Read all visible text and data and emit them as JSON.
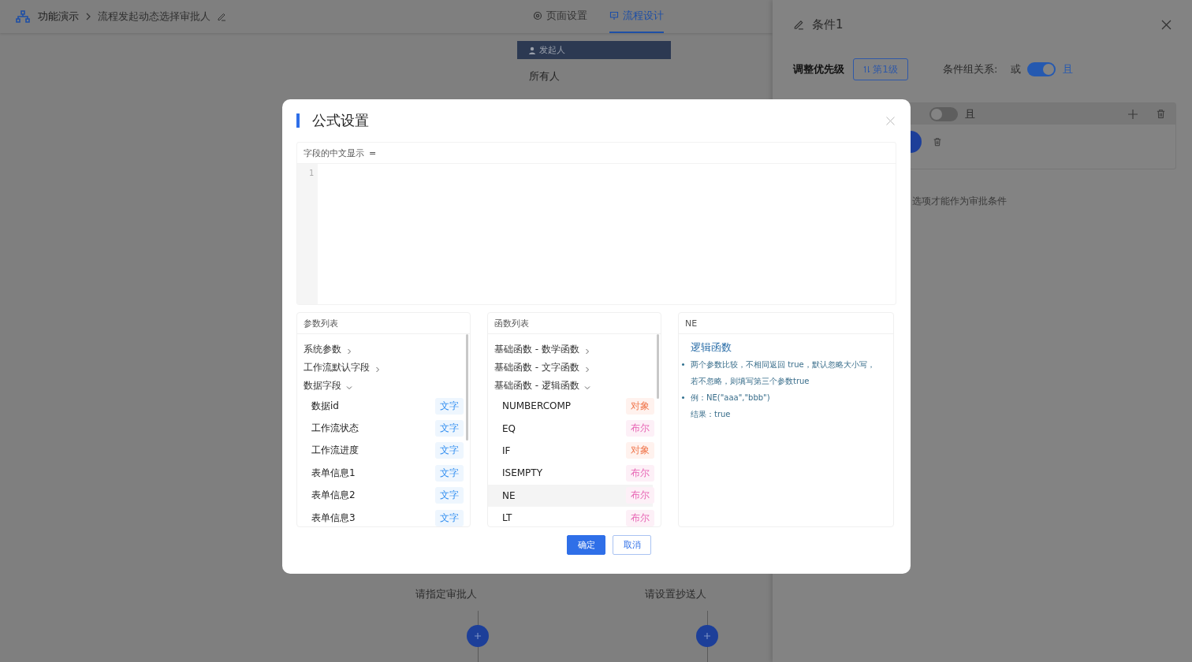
{
  "header": {
    "breadcrumb": [
      {
        "label": "功能演示"
      },
      {
        "label": "流程发起动态选择审批人"
      }
    ],
    "tabs": [
      {
        "label": "页面设置",
        "selected": false
      },
      {
        "label": "流程设计",
        "selected": true
      }
    ]
  },
  "flow": {
    "start_node": {
      "title": "发起人",
      "content": "所有人"
    },
    "branches": [
      {
        "label": "请指定审批人"
      },
      {
        "label": "请设置抄送人"
      }
    ]
  },
  "drawer": {
    "title": "条件1",
    "priority_label": "调整优先级",
    "priority_button": "第1级",
    "relation_label": "条件组关系:",
    "or_label": "或",
    "and_label": "且",
    "relation_on": true,
    "group": {
      "on": false,
      "and_label": "且"
    },
    "hint": "选项才能作为审批条件"
  },
  "modal": {
    "title": "公式设置",
    "editor": {
      "label": "字段的中文显示",
      "operator": "=",
      "line_numbers": [
        "1"
      ]
    },
    "params": {
      "title": "参数列表",
      "groups": [
        {
          "label": "系统参数",
          "expanded": false
        },
        {
          "label": "工作流默认字段",
          "expanded": false
        },
        {
          "label": "数据字段",
          "expanded": true,
          "children": [
            {
              "name": "数据id",
              "tag": "文字",
              "kind": "text",
              "selected": false
            },
            {
              "name": "工作流状态",
              "tag": "文字",
              "kind": "text",
              "selected": false
            },
            {
              "name": "工作流进度",
              "tag": "文字",
              "kind": "text",
              "selected": false
            },
            {
              "name": "表单信息1",
              "tag": "文字",
              "kind": "text",
              "selected": false
            },
            {
              "name": "表单信息2",
              "tag": "文字",
              "kind": "text",
              "selected": false
            },
            {
              "name": "表单信息3",
              "tag": "文字",
              "kind": "text",
              "selected": false
            }
          ]
        }
      ]
    },
    "functions": {
      "title": "函数列表",
      "groups": [
        {
          "label": "基础函数 - 数学函数",
          "expanded": false
        },
        {
          "label": "基础函数 - 文字函数",
          "expanded": false
        },
        {
          "label": "基础函数 - 逻辑函数",
          "expanded": true,
          "children": [
            {
              "name": "NUMBERCOMP",
              "tag": "对象",
              "kind": "object",
              "selected": false
            },
            {
              "name": "EQ",
              "tag": "布尔",
              "kind": "boolean",
              "selected": false
            },
            {
              "name": "IF",
              "tag": "对象",
              "kind": "object",
              "selected": false
            },
            {
              "name": "ISEMPTY",
              "tag": "布尔",
              "kind": "boolean",
              "selected": false
            },
            {
              "name": "NE",
              "tag": "布尔",
              "kind": "boolean",
              "selected": true
            },
            {
              "name": "LT",
              "tag": "布尔",
              "kind": "boolean",
              "selected": false
            }
          ]
        }
      ]
    },
    "detail": {
      "title": "NE",
      "heading": "逻辑函数",
      "bullets": [
        {
          "lines": [
            "两个参数比较，不相同返回 true，默认忽略大小写，",
            "若不忽略，则填写第三个参数true"
          ]
        },
        {
          "lines": [
            "例：NE(\"aaa\",\"bbb\")",
            "结果：true"
          ]
        }
      ]
    },
    "buttons": [
      {
        "label": "确定",
        "kind": "primary"
      },
      {
        "label": "取消",
        "kind": "default"
      }
    ]
  }
}
